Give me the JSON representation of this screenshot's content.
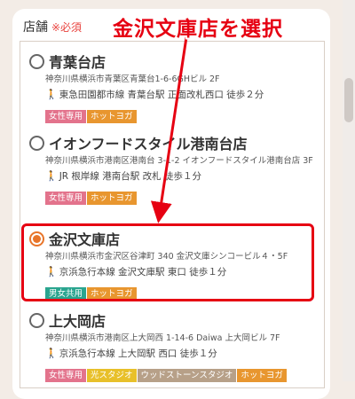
{
  "header": {
    "label": "店舗",
    "required": "※必須"
  },
  "annotation": {
    "text": "金沢文庫店を選択",
    "color": "#e60012"
  },
  "stores": [
    {
      "name": "青葉台店",
      "address": "神奈川県横浜市青葉区青葉台1-6-6GHビル 2F",
      "access": "東急田園都市線 青葉台駅 正面改札西口 徒歩２分",
      "tags": [
        {
          "label": "女性専用",
          "color": "pink"
        },
        {
          "label": "ホットヨガ",
          "color": "orange"
        }
      ],
      "selected": false
    },
    {
      "name": "イオンフードスタイル港南台店",
      "address": "神奈川県横浜市港南区港南台 3-1-2 イオンフードスタイル港南台店 3F",
      "access": "JR 根岸線 港南台駅 改札 徒歩１分",
      "tags": [
        {
          "label": "女性専用",
          "color": "pink"
        },
        {
          "label": "ホットヨガ",
          "color": "orange"
        }
      ],
      "selected": false
    },
    {
      "name": "金沢文庫店",
      "address": "神奈川県横浜市金沢区谷津町 340 金沢文庫シンコービル４・5F",
      "access": "京浜急行本線 金沢文庫駅 東口 徒歩１分",
      "tags": [
        {
          "label": "男女共用",
          "color": "teal"
        },
        {
          "label": "ホットヨガ",
          "color": "orange"
        }
      ],
      "selected": true
    },
    {
      "name": "上大岡店",
      "address": "神奈川県横浜市港南区上大岡西 1-14-6 Daiwa 上大岡ビル 7F",
      "access": "京浜急行本線 上大岡駅 西口 徒歩１分",
      "tags": [
        {
          "label": "女性専用",
          "color": "pink"
        },
        {
          "label": "光スタジオ",
          "color": "yellow"
        },
        {
          "label": "ウッドストーンスタジオ",
          "color": "gray"
        },
        {
          "label": "ホットヨガ",
          "color": "orange"
        }
      ],
      "selected": false
    }
  ]
}
